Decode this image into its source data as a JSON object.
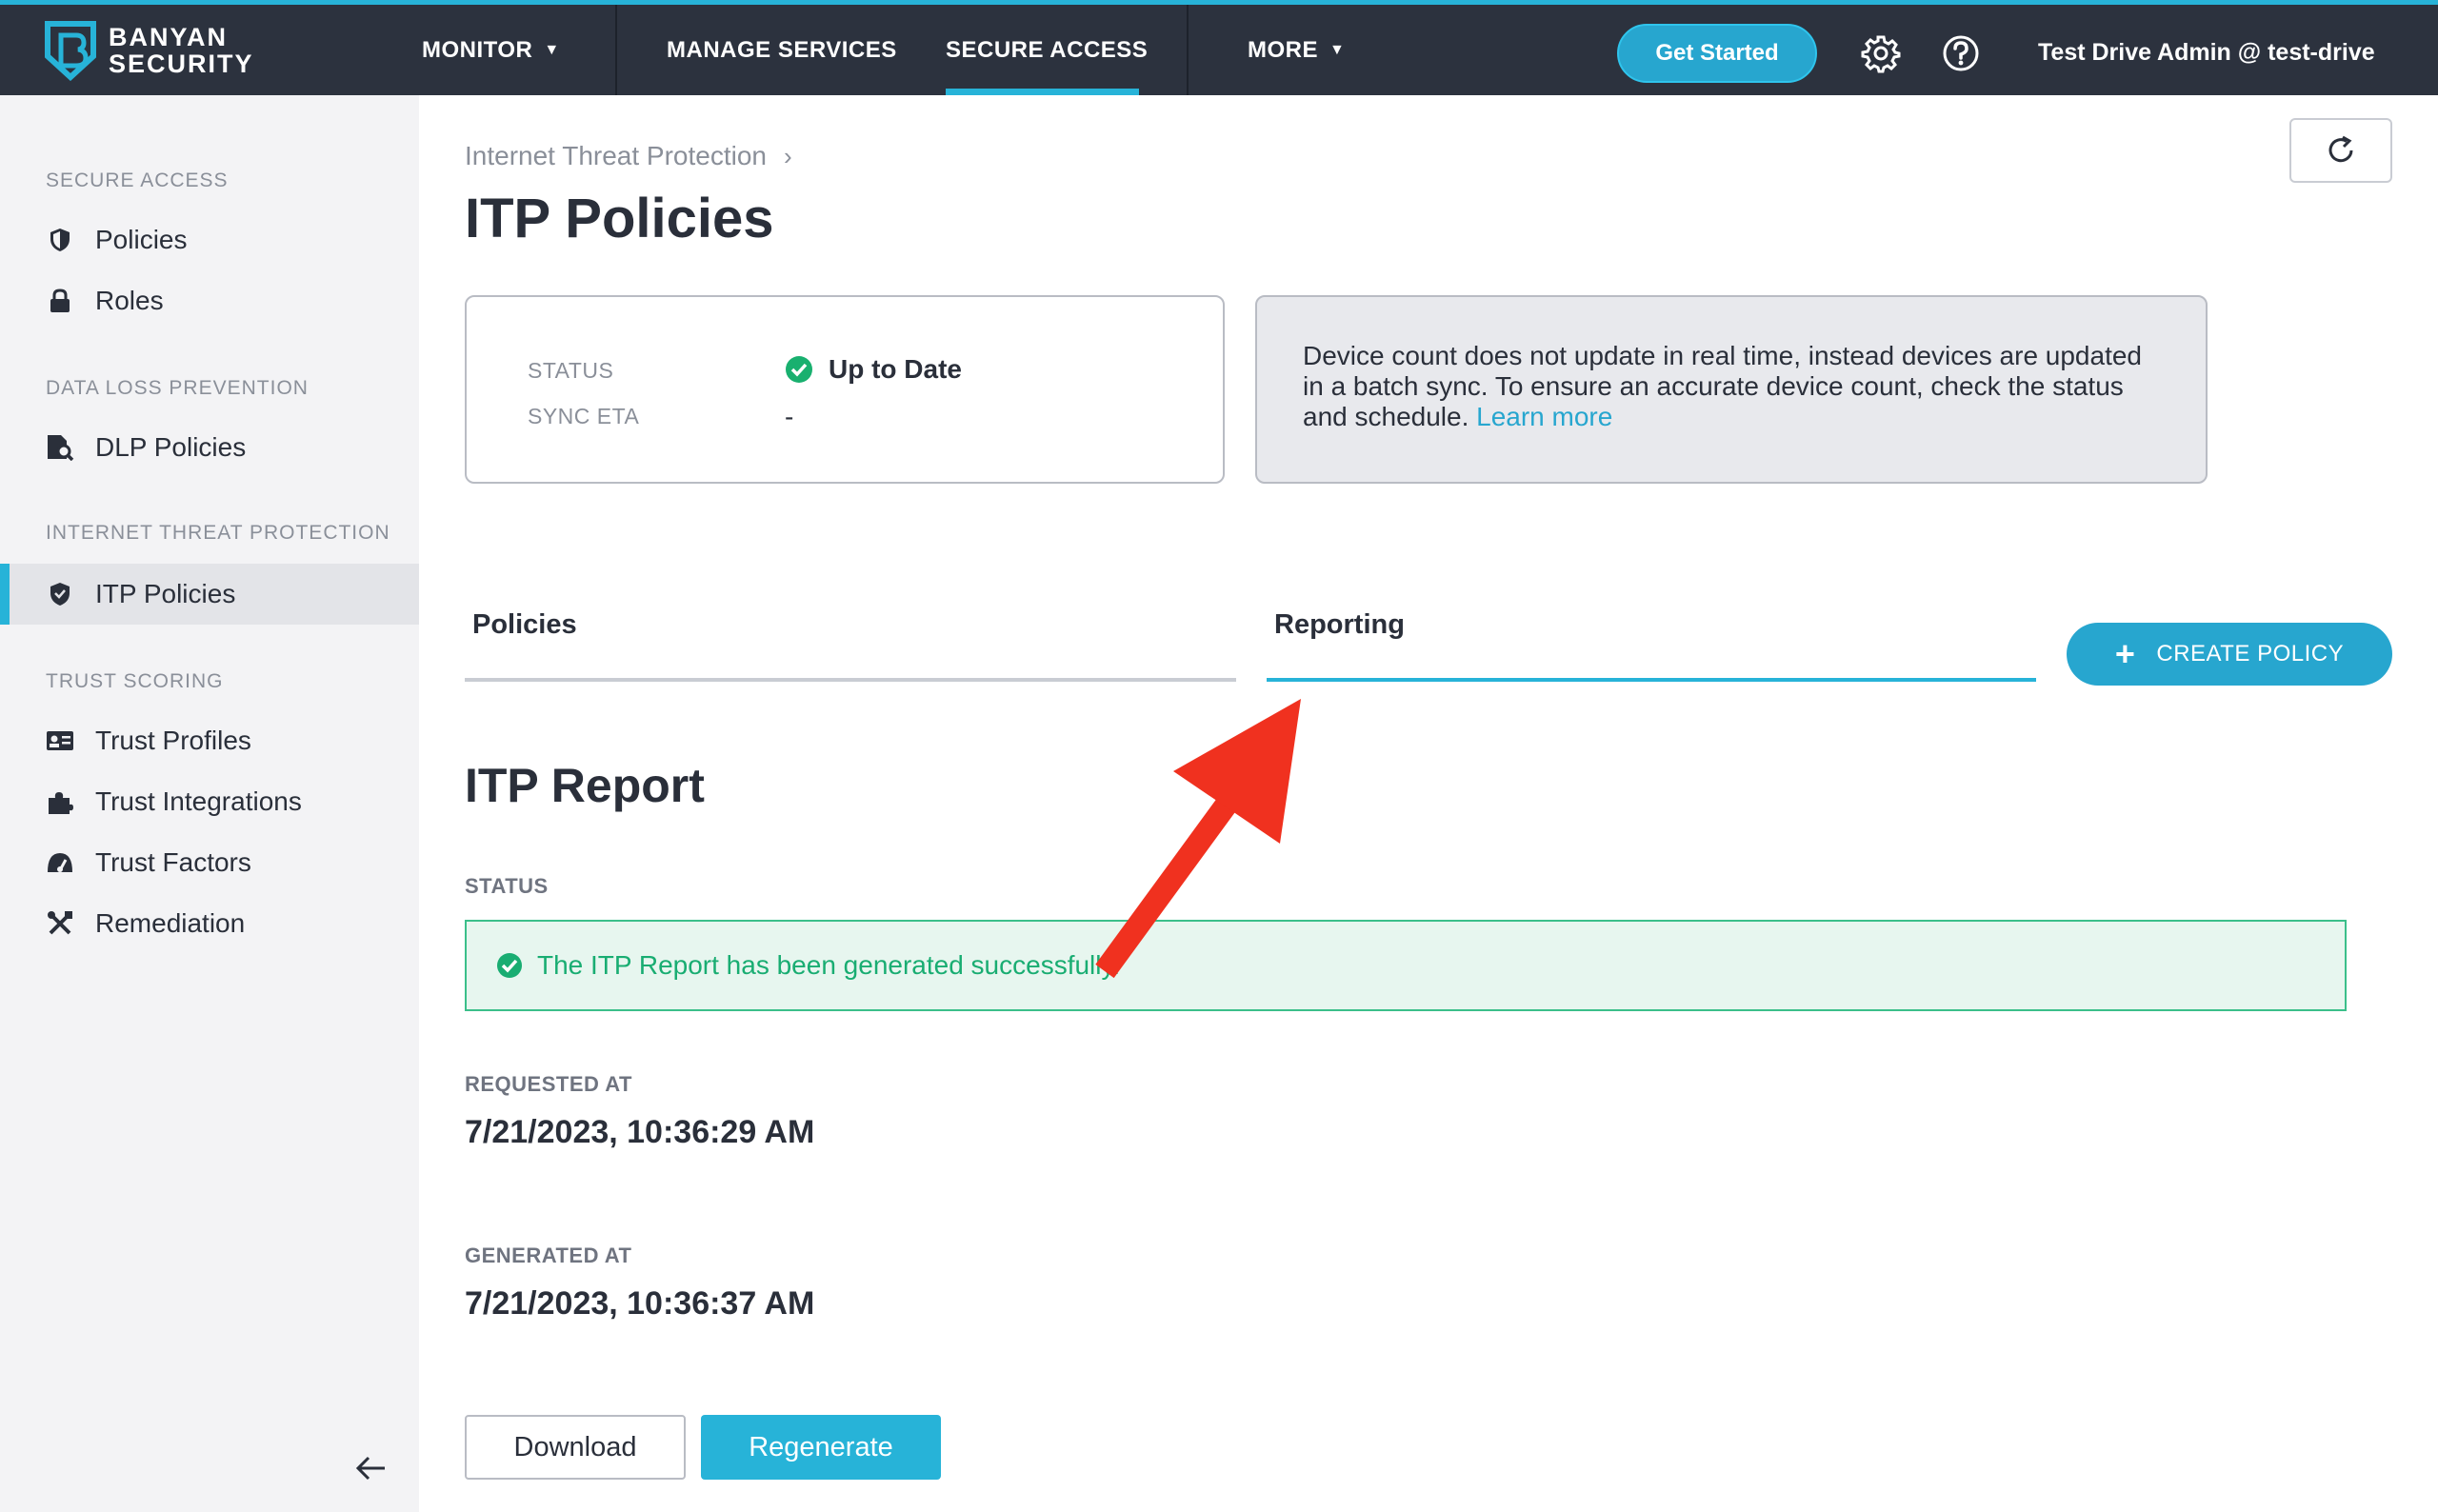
{
  "brand": {
    "line1": "BANYAN",
    "line2": "SECURITY"
  },
  "topnav": {
    "items": [
      {
        "label": "MONITOR",
        "has_caret": true
      },
      {
        "label": "MANAGE SERVICES",
        "has_caret": false
      },
      {
        "label": "SECURE ACCESS",
        "has_caret": false,
        "active": true
      },
      {
        "label": "MORE",
        "has_caret": true
      }
    ],
    "caret": "▼",
    "get_started": "Get Started",
    "settings_icon": "gear-icon",
    "help_icon": "help-icon",
    "user": "Test Drive Admin @ test-drive"
  },
  "sidebar": {
    "sections": [
      {
        "title": "SECURE ACCESS",
        "items": [
          {
            "label": "Policies",
            "icon": "shield-icon"
          },
          {
            "label": "Roles",
            "icon": "lock-icon"
          }
        ]
      },
      {
        "title": "DATA LOSS PREVENTION",
        "items": [
          {
            "label": "DLP Policies",
            "icon": "document-search-icon"
          }
        ]
      },
      {
        "title": "INTERNET THREAT PROTECTION",
        "items": [
          {
            "label": "ITP Policies",
            "icon": "shield-check-icon",
            "active": true
          }
        ]
      },
      {
        "title": "TRUST SCORING",
        "items": [
          {
            "label": "Trust Profiles",
            "icon": "id-card-icon"
          },
          {
            "label": "Trust Integrations",
            "icon": "puzzle-icon"
          },
          {
            "label": "Trust Factors",
            "icon": "gauge-icon"
          },
          {
            "label": "Remediation",
            "icon": "tools-icon"
          }
        ]
      }
    ],
    "collapse_icon": "arrow-left-icon"
  },
  "main": {
    "breadcrumb": {
      "label": "Internet Threat Protection",
      "separator": "›"
    },
    "title": "ITP Policies",
    "status_card": {
      "status_label": "STATUS",
      "status_value": "Up to Date",
      "sync_label": "SYNC ETA",
      "sync_value": "-"
    },
    "info_card": {
      "text": "Device count does not update in real time, instead devices are updated in a batch sync. To ensure an accurate device count, check the status and schedule.",
      "link": "Learn more"
    },
    "tabs": [
      {
        "label": "Policies",
        "active": false
      },
      {
        "label": "Reporting",
        "active": true
      }
    ],
    "create_policy": {
      "plus": "+",
      "label": "CREATE POLICY"
    },
    "report": {
      "title": "ITP Report",
      "status_label": "STATUS",
      "status_message": "The ITP Report has been generated successfully.",
      "requested_label": "REQUESTED AT",
      "requested_value": "7/21/2023, 10:36:29 AM",
      "generated_label": "GENERATED AT",
      "generated_value": "7/21/2023, 10:36:37 AM",
      "download": "Download",
      "regenerate": "Regenerate"
    }
  },
  "colors": {
    "accent": "#27b3d8",
    "topbar": "#2c323e",
    "success": "#19ad72",
    "annotation_arrow": "#f0311f"
  }
}
